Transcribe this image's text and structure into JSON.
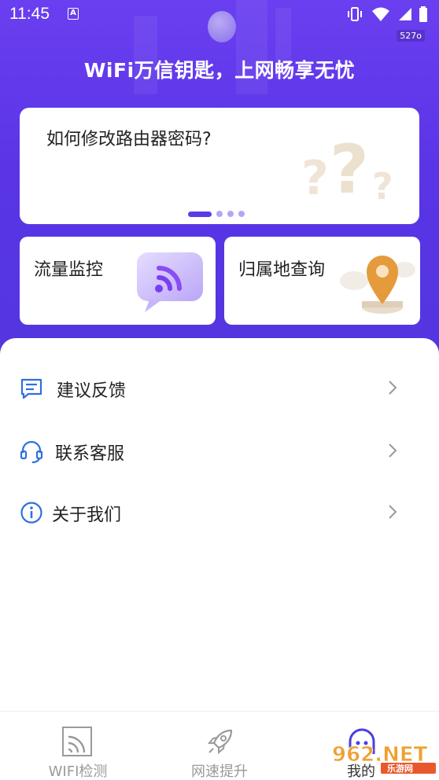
{
  "status_bar": {
    "time": "11:45",
    "net_speed": "527o"
  },
  "hero": {
    "headline": "WiFi万信钥匙，上网畅享无忧"
  },
  "banner": {
    "title": "如何修改路由器密码?",
    "pages": 4,
    "active_page": 1
  },
  "cards": [
    {
      "label": "流量监控",
      "icon": "wifi-chat-bubble-icon"
    },
    {
      "label": "归属地查询",
      "icon": "location-pin-icon"
    }
  ],
  "menu": [
    {
      "label": "建议反馈",
      "icon": "feedback-icon"
    },
    {
      "label": "联系客服",
      "icon": "headset-icon"
    },
    {
      "label": "关于我们",
      "icon": "info-icon"
    }
  ],
  "tabbar": {
    "tabs": [
      {
        "label": "WIFI检测",
        "icon": "wifi-detect-icon"
      },
      {
        "label": "网速提升",
        "icon": "rocket-icon"
      },
      {
        "label": "我的",
        "icon": "profile-face-icon",
        "active": true
      }
    ]
  },
  "watermark": {
    "text": "962.NET",
    "subtext": "乐游网"
  },
  "colors": {
    "hero_top": "#6a3ff0",
    "hero_bottom": "#5335df",
    "accent": "#5a3be8",
    "icon_blue": "#2f6fe0"
  }
}
